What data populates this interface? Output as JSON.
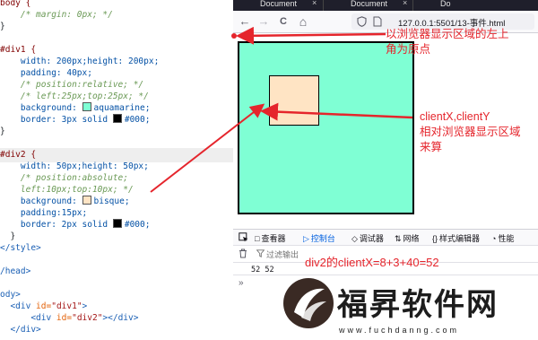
{
  "editor": {
    "lines": [
      {
        "parts": [
          {
            "c": "sel",
            "t": "body {"
          }
        ]
      },
      {
        "parts": [
          {
            "c": "cmt",
            "t": "    /* margin: 0px; */"
          }
        ]
      },
      {
        "parts": [
          {
            "c": "",
            "t": "}"
          }
        ]
      },
      {
        "parts": []
      },
      {
        "parts": [
          {
            "c": "sel",
            "t": "#div1 {"
          }
        ]
      },
      {
        "parts": [
          {
            "c": "prop",
            "t": "    width: 200px;height: 200px;"
          }
        ]
      },
      {
        "parts": [
          {
            "c": "prop",
            "t": "    padding: 40px;"
          }
        ]
      },
      {
        "parts": [
          {
            "c": "cmt",
            "t": "    /* position:relative; */"
          }
        ]
      },
      {
        "parts": [
          {
            "c": "cmt",
            "t": "    /* left:25px;top:25px; */"
          }
        ]
      },
      {
        "parts": [
          {
            "c": "prop",
            "t": "    background: "
          },
          {
            "c": "swatch-aqua",
            "t": ""
          },
          {
            "c": "val",
            "t": "aquamarine;"
          }
        ]
      },
      {
        "parts": [
          {
            "c": "prop",
            "t": "    border: 3px solid "
          },
          {
            "c": "swatch-black",
            "t": ""
          },
          {
            "c": "val",
            "t": "#000;"
          }
        ]
      },
      {
        "parts": [
          {
            "c": "",
            "t": "}"
          }
        ]
      },
      {
        "parts": []
      },
      {
        "parts": [
          {
            "c": "sel",
            "t": "#div2 {"
          }
        ]
      },
      {
        "parts": [
          {
            "c": "prop",
            "t": "    width: 50px;height: 50px;"
          }
        ]
      },
      {
        "parts": [
          {
            "c": "cmt",
            "t": "    /* position:absolute;"
          }
        ]
      },
      {
        "parts": [
          {
            "c": "cmt",
            "t": "    left:10px;top:10px; */"
          }
        ]
      },
      {
        "parts": [
          {
            "c": "prop",
            "t": "    background: "
          },
          {
            "c": "swatch-bisque",
            "t": ""
          },
          {
            "c": "val",
            "t": "bisque;"
          }
        ]
      },
      {
        "parts": [
          {
            "c": "prop",
            "t": "    padding:15px;"
          }
        ]
      },
      {
        "parts": [
          {
            "c": "prop",
            "t": "    border: 2px solid "
          },
          {
            "c": "swatch-black",
            "t": ""
          },
          {
            "c": "val",
            "t": "#000;"
          }
        ]
      },
      {
        "parts": [
          {
            "c": "",
            "t": "  }"
          }
        ]
      },
      {
        "parts": [
          {
            "c": "tag",
            "t": "</style>"
          }
        ]
      },
      {
        "parts": []
      },
      {
        "parts": [
          {
            "c": "tag",
            "t": "/head>"
          }
        ]
      },
      {
        "parts": []
      },
      {
        "parts": [
          {
            "c": "tag",
            "t": "ody>"
          }
        ]
      },
      {
        "parts": [
          {
            "c": "tag",
            "t": "  <div "
          },
          {
            "c": "attr",
            "t": "id="
          },
          {
            "c": "str",
            "t": "\"div1\""
          },
          {
            "c": "tag",
            "t": ">"
          }
        ]
      },
      {
        "parts": [
          {
            "c": "tag",
            "t": "      <div "
          },
          {
            "c": "attr",
            "t": "id="
          },
          {
            "c": "str",
            "t": "\"div2\""
          },
          {
            "c": "tag",
            "t": "></div>"
          }
        ]
      },
      {
        "parts": [
          {
            "c": "tag",
            "t": "  </div>"
          }
        ]
      }
    ],
    "highlight_line": 13
  },
  "browser": {
    "tabs": [
      {
        "label": "Document",
        "close": "×"
      },
      {
        "label": "Document",
        "close": "×"
      },
      {
        "label": "Do",
        "close": ""
      }
    ],
    "nav": {
      "back": "←",
      "forward": "→",
      "reload": "C",
      "home": "⌂"
    },
    "url": "127.0.0.1:5501/13-事件.html",
    "url_icons": [
      "shield-icon",
      "page-icon"
    ]
  },
  "annotations": {
    "origin": "以浏览器显示区域的左上\n角为原点",
    "client": "clientX,clientY\n相对浏览器显示区域\n来算",
    "formula": "div2的clientX=8+3+40=52"
  },
  "devtools": {
    "tabs": [
      {
        "icon": "□",
        "label": "查看器",
        "active": false
      },
      {
        "icon": "▷",
        "label": "控制台",
        "active": true
      },
      {
        "icon": "◇",
        "label": "调试器",
        "active": false
      },
      {
        "icon": "⇅",
        "label": "网络",
        "active": false
      },
      {
        "icon": "{}",
        "label": "样式编辑器",
        "active": false
      },
      {
        "icon": "◔",
        "label": "性能",
        "active": false
      }
    ],
    "filter_placeholder": "过滤输出",
    "output": "52 52",
    "prompt": "»"
  },
  "watermark": {
    "title": "福昇软件网",
    "sub": "www.fuchdanng.com"
  },
  "colors": {
    "annotation": "#e5252c",
    "div1": "#7fffd4",
    "div2": "#ffe4c4",
    "active_tab": "#0060df"
  }
}
